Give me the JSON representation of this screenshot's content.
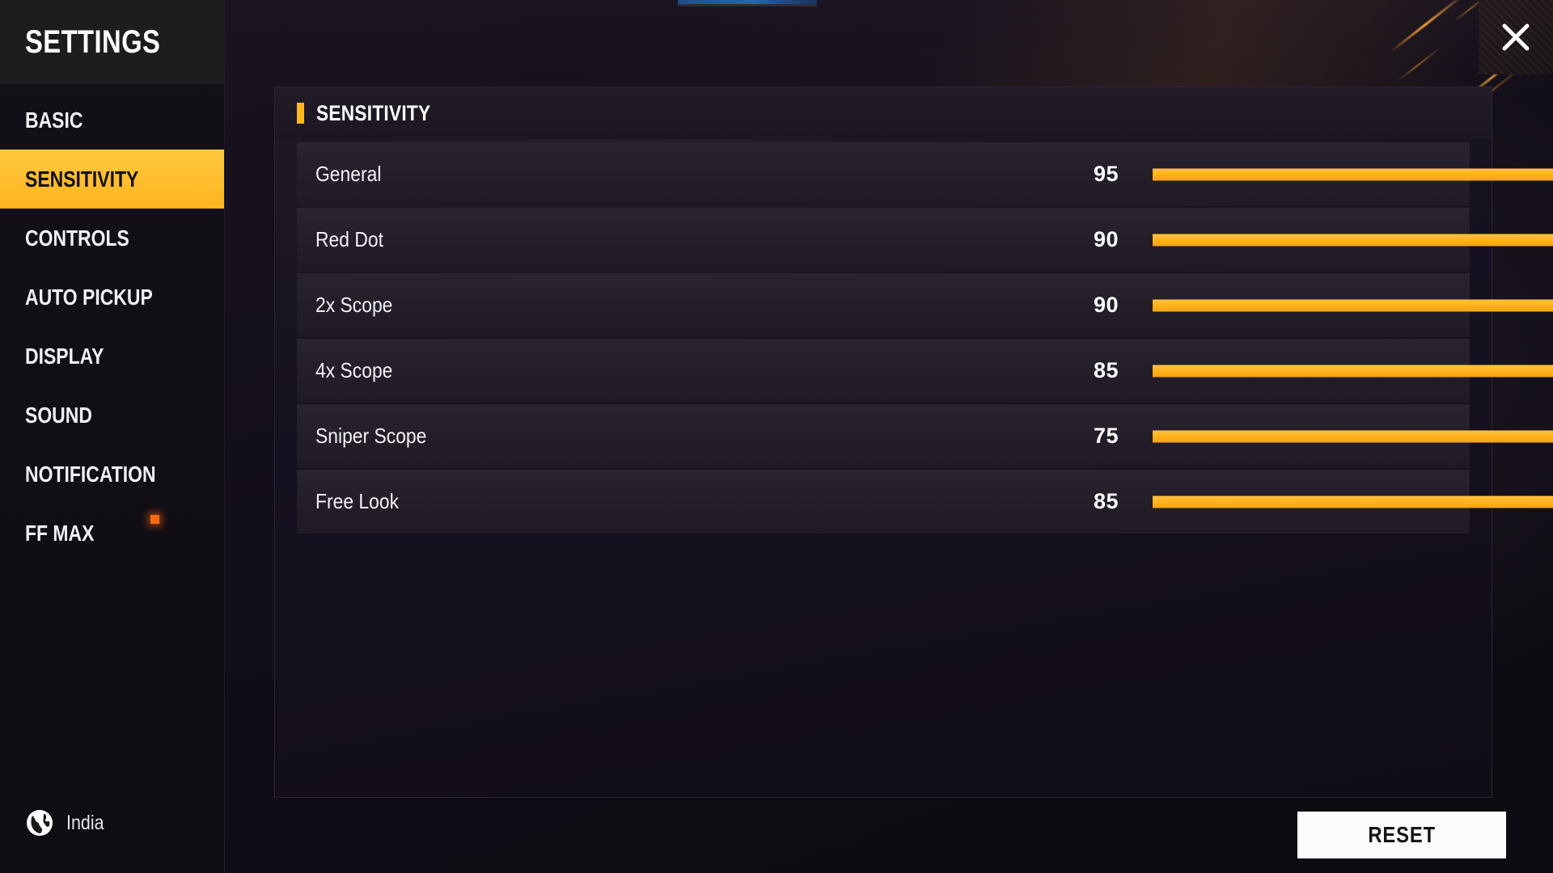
{
  "sidebar": {
    "title": "SETTINGS",
    "items": [
      {
        "label": "BASIC",
        "active": false,
        "dot": false
      },
      {
        "label": "SENSITIVITY",
        "active": true,
        "dot": false
      },
      {
        "label": "CONTROLS",
        "active": false,
        "dot": false
      },
      {
        "label": "AUTO PICKUP",
        "active": false,
        "dot": false
      },
      {
        "label": "DISPLAY",
        "active": false,
        "dot": false
      },
      {
        "label": "SOUND",
        "active": false,
        "dot": false
      },
      {
        "label": "NOTIFICATION",
        "active": false,
        "dot": false
      },
      {
        "label": "FF MAX",
        "active": false,
        "dot": true
      }
    ],
    "region": {
      "label": "India",
      "icon": "globe-icon"
    }
  },
  "header": {
    "close_icon": "close-icon"
  },
  "panel": {
    "title": "SENSITIVITY",
    "accent_color": "#ffb81f",
    "slider_min": 0,
    "slider_max": 100,
    "rows": [
      {
        "name": "General",
        "value": 95
      },
      {
        "name": "Red Dot",
        "value": 90
      },
      {
        "name": "2x Scope",
        "value": 90
      },
      {
        "name": "4x Scope",
        "value": 85
      },
      {
        "name": "Sniper Scope",
        "value": 75
      },
      {
        "name": "Free Look",
        "value": 85
      }
    ]
  },
  "footer": {
    "reset_label": "RESET"
  }
}
